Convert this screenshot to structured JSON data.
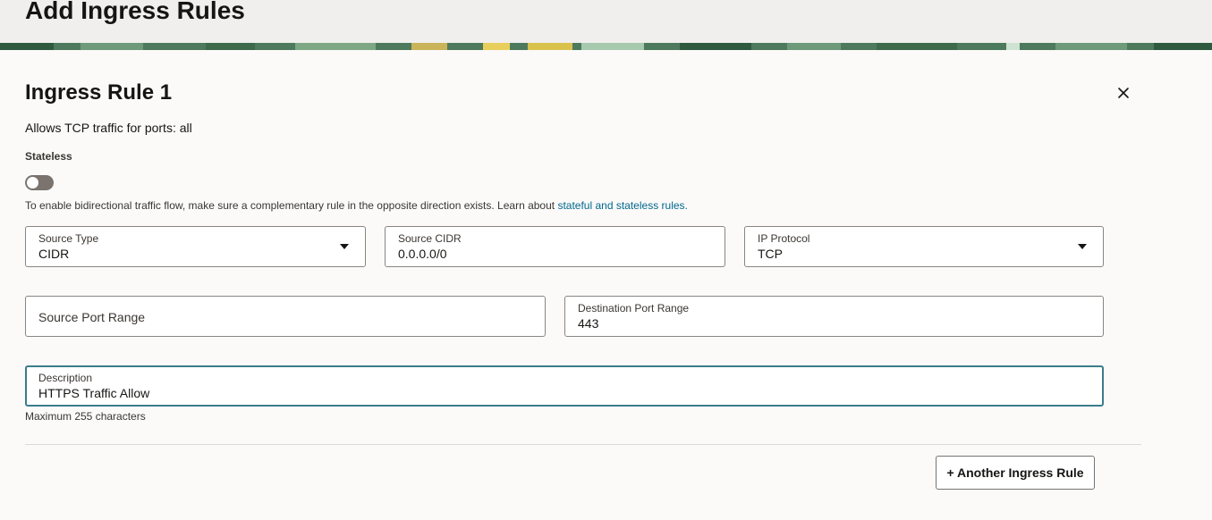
{
  "page": {
    "title": "Add Ingress Rules"
  },
  "colors": {
    "accent_link": "#00688c",
    "focus_border": "#3b7d8a",
    "banner_green": "#4d7a5d"
  },
  "rule": {
    "title": "Ingress Rule 1",
    "close_icon": "close-icon",
    "summary": "Allows TCP traffic for ports: all",
    "stateless": {
      "label": "Stateless",
      "enabled": false,
      "help_text": "To enable bidirectional traffic flow, make sure a complementary rule in the opposite direction exists. Learn about",
      "help_link": "stateful and stateless rules."
    },
    "fields": {
      "source_type": {
        "label": "Source Type",
        "value": "CIDR"
      },
      "source_cidr": {
        "label": "Source CIDR",
        "value": "0.0.0.0/0"
      },
      "ip_protocol": {
        "label": "IP Protocol",
        "value": "TCP"
      },
      "source_port_range": {
        "placeholder": "Source Port Range"
      },
      "destination_port_range": {
        "label": "Destination Port Range",
        "value": "443"
      },
      "description": {
        "label": "Description",
        "value": "HTTPS Traffic Allow",
        "hint": "Maximum 255 characters"
      }
    }
  },
  "actions": {
    "add_rule": "+ Another Ingress Rule"
  }
}
